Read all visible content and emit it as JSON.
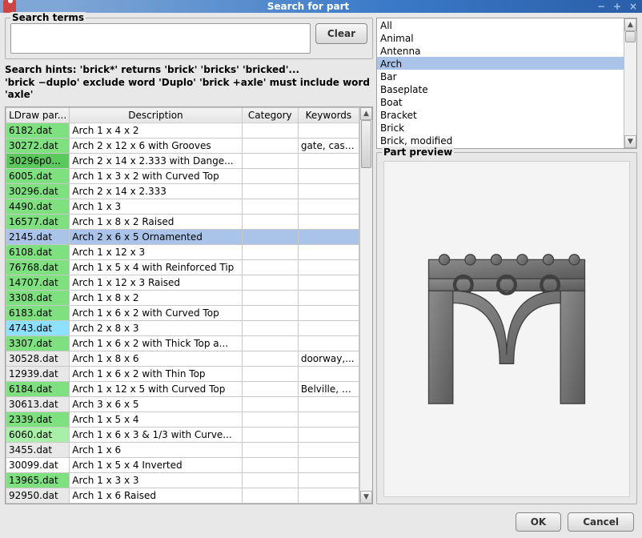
{
  "title": "Search for part",
  "titlebar_icons": {
    "min": "−",
    "max": "+",
    "close": "×"
  },
  "search": {
    "label": "Search terms",
    "value": "",
    "clear": "Clear"
  },
  "hints_line1": "Search hints: 'brick*' returns 'brick' 'bricks' 'bricked'...",
  "hints_line2": "'brick −duplo' exclude word 'Duplo' 'brick +axle' must include word 'axle'",
  "table": {
    "headers": [
      "LDraw par...",
      "Description",
      "Category",
      "Keywords"
    ],
    "rows": [
      {
        "file": "6182.dat",
        "desc": "Arch  1 x  4 x  2",
        "cat": "",
        "kw": "",
        "color": "green"
      },
      {
        "file": "30272.dat",
        "desc": "Arch  2 x 12 x  6 with Grooves",
        "cat": "",
        "kw": "gate, cast...",
        "color": "green"
      },
      {
        "file": "30296p0...",
        "desc": "Arch  2 x 14 x  2.333 with Dange...",
        "cat": "",
        "kw": "",
        "color": "dkgreen"
      },
      {
        "file": "6005.dat",
        "desc": "Arch  1 x  3 x  2 with Curved Top",
        "cat": "",
        "kw": "",
        "color": "green"
      },
      {
        "file": "30296.dat",
        "desc": "Arch  2 x 14 x  2.333",
        "cat": "",
        "kw": "",
        "color": "green"
      },
      {
        "file": "4490.dat",
        "desc": "Arch  1 x  3",
        "cat": "",
        "kw": "",
        "color": "green"
      },
      {
        "file": "16577.dat",
        "desc": "Arch  1 x  8 x  2 Raised",
        "cat": "",
        "kw": "",
        "color": "green"
      },
      {
        "file": "2145.dat",
        "desc": "Arch  2 x  6 x  5 Ornamented",
        "cat": "",
        "kw": "",
        "color": "green",
        "selected": true
      },
      {
        "file": "6108.dat",
        "desc": "Arch  1 x 12 x  3",
        "cat": "",
        "kw": "",
        "color": "green"
      },
      {
        "file": "76768.dat",
        "desc": "Arch  1 x  5 x  4 with Reinforced Tip",
        "cat": "",
        "kw": "",
        "color": "green"
      },
      {
        "file": "14707.dat",
        "desc": "Arch  1 x 12 x  3 Raised",
        "cat": "",
        "kw": "",
        "color": "green"
      },
      {
        "file": "3308.dat",
        "desc": "Arch  1 x  8 x  2",
        "cat": "",
        "kw": "",
        "color": "green"
      },
      {
        "file": "6183.dat",
        "desc": "Arch  1 x  6 x  2 with Curved Top",
        "cat": "",
        "kw": "",
        "color": "green"
      },
      {
        "file": "4743.dat",
        "desc": "Arch  2 x  8 x  3",
        "cat": "",
        "kw": "",
        "color": "cyan"
      },
      {
        "file": "3307.dat",
        "desc": "Arch  1 x  6 x  2 with Thick Top a...",
        "cat": "",
        "kw": "",
        "color": "green"
      },
      {
        "file": "30528.dat",
        "desc": "Arch  1 x  8 x  6",
        "cat": "",
        "kw": "doorway,...",
        "color": "gray"
      },
      {
        "file": "12939.dat",
        "desc": "Arch  1 x  6 x  2 with Thin Top",
        "cat": "",
        "kw": "",
        "color": "gray"
      },
      {
        "file": "6184.dat",
        "desc": "Arch  1 x 12 x  5 with Curved Top",
        "cat": "",
        "kw": "Belville, S...",
        "color": "green"
      },
      {
        "file": "30613.dat",
        "desc": "Arch  3 x  6 x  5",
        "cat": "",
        "kw": "",
        "color": "gray"
      },
      {
        "file": "2339.dat",
        "desc": "Arch  1 x  5 x  4",
        "cat": "",
        "kw": "",
        "color": "green"
      },
      {
        "file": "6060.dat",
        "desc": "Arch  1 x  6 x  3  & 1/3 with Curve...",
        "cat": "",
        "kw": "",
        "color": "ltgreen"
      },
      {
        "file": "3455.dat",
        "desc": "Arch  1 x  6",
        "cat": "",
        "kw": "",
        "color": "gray"
      },
      {
        "file": "30099.dat",
        "desc": "Arch  1 x  5 x  4 Inverted",
        "cat": "",
        "kw": "",
        "color": "white"
      },
      {
        "file": "13965.dat",
        "desc": "Arch  1 x  3 x  3",
        "cat": "",
        "kw": "",
        "color": "green"
      },
      {
        "file": "92950.dat",
        "desc": "Arch  1 x  6 Raised",
        "cat": "",
        "kw": "",
        "color": "gray"
      }
    ]
  },
  "categories": [
    "All",
    "Animal",
    "Antenna",
    "Arch",
    "Bar",
    "Baseplate",
    "Boat",
    "Bracket",
    "Brick",
    "Brick,  modified"
  ],
  "category_selected": "Arch",
  "preview": {
    "label": "Part preview"
  },
  "buttons": {
    "ok": "OK",
    "cancel": "Cancel"
  }
}
